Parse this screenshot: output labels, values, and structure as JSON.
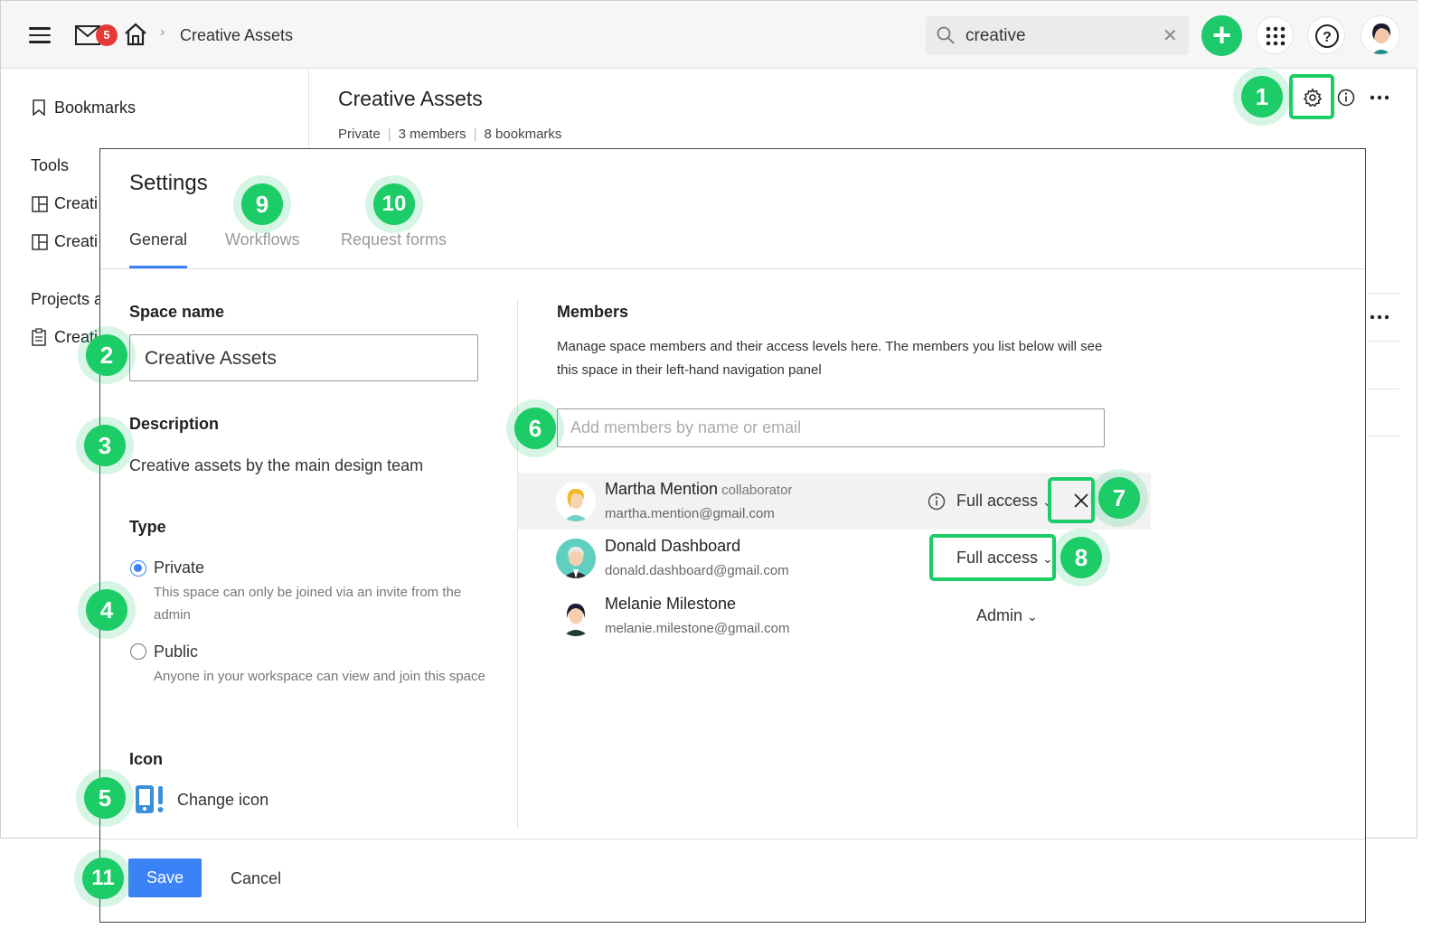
{
  "topbar": {
    "mail_badge": "5",
    "breadcrumb": "Creative Assets",
    "search_value": "creative",
    "search_clear": "✕",
    "plus": "+"
  },
  "sidebar": {
    "bookmarks": "Bookmarks",
    "tools_heading": "Tools",
    "tools_items": [
      "Creati",
      "Creati"
    ],
    "projects_heading": "Projects a",
    "projects_items": [
      "Creati"
    ]
  },
  "page": {
    "title": "Creative Assets",
    "meta": [
      "Private",
      "3 members",
      "8 bookmarks"
    ]
  },
  "modal": {
    "title": "Settings",
    "tabs": [
      "General",
      "Workflows",
      "Request forms"
    ],
    "space_name_label": "Space name",
    "space_name_value": "Creative Assets",
    "description_label": "Description",
    "description_value": "Creative assets by the main design team",
    "type_label": "Type",
    "type_options": [
      {
        "label": "Private",
        "help": "This space can only be joined via an invite from the admin",
        "selected": true
      },
      {
        "label": "Public",
        "help": "Anyone in your workspace can view and join this space",
        "selected": false
      }
    ],
    "icon_label": "Icon",
    "change_icon": "Change icon",
    "members_label": "Members",
    "members_help": "Manage space members and their access levels here. The members you list below will see this space in their left-hand navigation panel",
    "add_members_placeholder": "Add members by name or email",
    "members": [
      {
        "name": "Martha Mention",
        "role": "collaborator",
        "email": "martha.mention@gmail.com",
        "access": "Full access"
      },
      {
        "name": "Donald Dashboard",
        "role": "",
        "email": "donald.dashboard@gmail.com",
        "access": "Full access"
      },
      {
        "name": "Melanie Milestone",
        "role": "",
        "email": "melanie.milestone@gmail.com",
        "access": "Admin"
      }
    ],
    "save": "Save",
    "cancel": "Cancel"
  },
  "callouts": [
    "1",
    "2",
    "3",
    "4",
    "5",
    "6",
    "7",
    "8",
    "9",
    "10",
    "11"
  ],
  "colors": {
    "accent_green": "#1ccc66",
    "primary_blue": "#3b82f6",
    "badge_red": "#e53935"
  }
}
